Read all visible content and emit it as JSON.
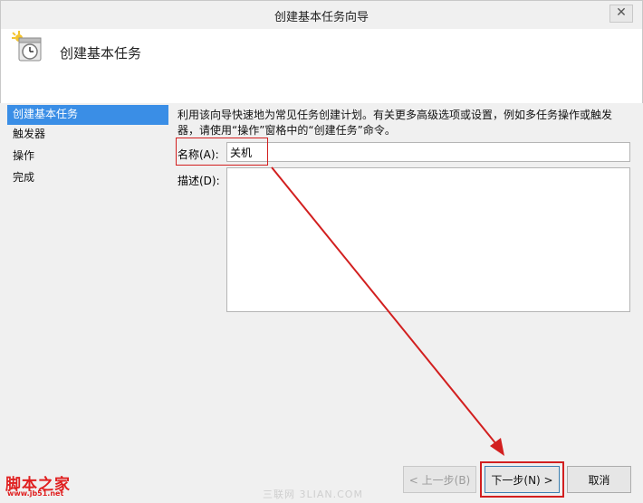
{
  "window": {
    "title": "创建基本任务向导",
    "close_glyph": "✕"
  },
  "header": {
    "title": "创建基本任务"
  },
  "sidebar": {
    "items": [
      {
        "label": "创建基本任务"
      },
      {
        "label": "触发器"
      },
      {
        "label": "操作"
      },
      {
        "label": "完成"
      }
    ]
  },
  "main": {
    "description": "利用该向导快速地为常见任务创建计划。有关更多高级选项或设置，例如多任务操作或触发器，请使用“操作”窗格中的“创建任务”命令。",
    "name_label": "名称(A):",
    "name_value": "关机",
    "desc_label": "描述(D):",
    "desc_value": ""
  },
  "buttons": {
    "prev": "< 上一步(B)",
    "next": "下一步(N) >",
    "cancel": "取消"
  },
  "annotations": {
    "highlight_color": "#d21f1f"
  },
  "branding": {
    "logo_text": "脚本之家",
    "logo_url": "www.jb51.net",
    "watermark": "三联网 3LIAN.COM"
  },
  "colors": {
    "selection": "#3a8ee6"
  }
}
